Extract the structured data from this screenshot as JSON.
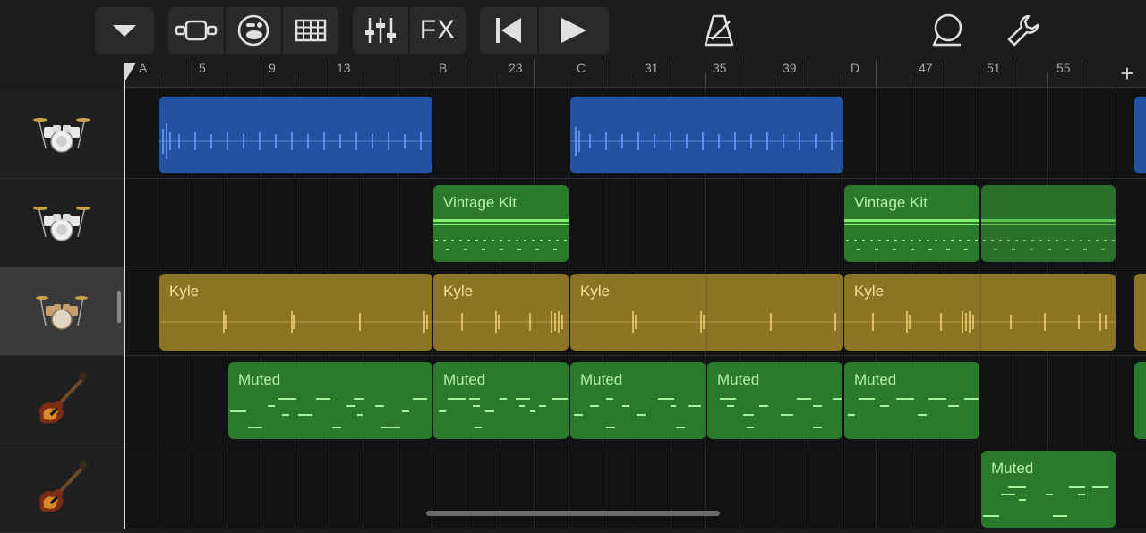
{
  "toolbar": {
    "menu_icon": "chevron-down-icon",
    "view_icons": [
      "tracks-view-icon",
      "live-loops-icon",
      "grid-view-icon"
    ],
    "mixer_icon": "sliders-icon",
    "fx_label": "FX",
    "transport_icons": [
      "go-to-beginning-icon",
      "play-icon"
    ],
    "metronome_icon": "metronome-icon",
    "loop_icon": "loop-browser-icon",
    "settings_icon": "wrench-icon"
  },
  "ruler": {
    "labels": [
      "A",
      "5",
      "9",
      "13",
      "B",
      "23",
      "C",
      "31",
      "35",
      "39",
      "D",
      "47",
      "51",
      "55"
    ],
    "add_label": "+"
  },
  "tracks": [
    {
      "instrument": "drum-kit",
      "selected": false
    },
    {
      "instrument": "drum-kit",
      "selected": false
    },
    {
      "instrument": "drum-kit",
      "selected": true
    },
    {
      "instrument": "bass-guitar",
      "selected": false
    },
    {
      "instrument": "bass-guitar",
      "selected": false
    }
  ],
  "regions": {
    "r1": "",
    "r2": "",
    "r3": "Vintage Kit",
    "r4": "Vintage Kit",
    "r5": "Kyle",
    "r6": "Kyle",
    "r7": "Kyle",
    "r8": "Kyle",
    "r9": "Muted",
    "r10": "Muted",
    "r11": "Muted",
    "r12": "Muted",
    "r13": "Muted",
    "r14": "Muted"
  },
  "colors": {
    "audio_region": "#2452a3",
    "drummer_region": "#2b7a2b",
    "gold_region": "#8d7424",
    "midi_region": "#2b7a2b",
    "background": "#111214"
  }
}
